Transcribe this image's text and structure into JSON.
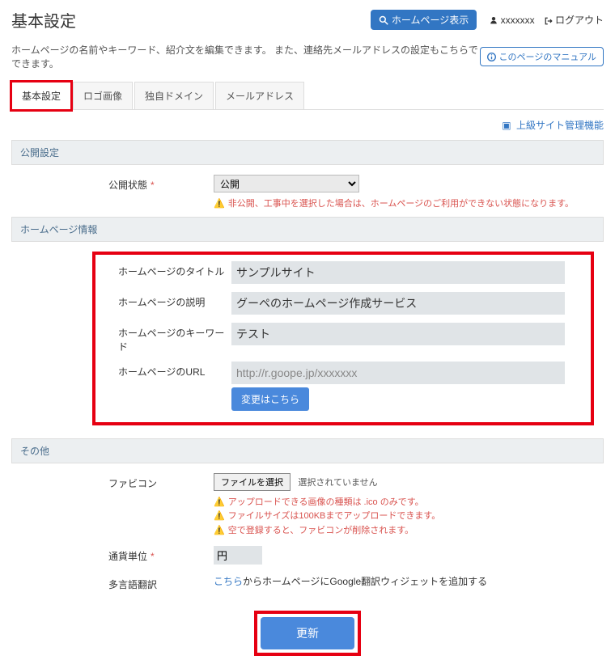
{
  "header": {
    "page_title": "基本設定",
    "view_hp_label": "ホームページ表示",
    "username": "xxxxxxx",
    "logout_label": "ログアウト"
  },
  "description": "ホームページの名前やキーワード、紹介文を編集できます。 また、連絡先メールアドレスの設定もこちらでできます。",
  "manual_link": "このページのマニュアル",
  "tabs": [
    "基本設定",
    "ロゴ画像",
    "独自ドメイン",
    "メールアドレス"
  ],
  "ext_link": "上級サイト管理機能",
  "sections": {
    "publish": {
      "title": "公開設定",
      "status_label": "公開状態",
      "status_value": "公開",
      "warn": "非公開、工事中を選択した場合は、ホームページのご利用ができない状態になります。"
    },
    "hpinfo": {
      "title": "ホームページ情報",
      "rows": {
        "title_label": "ホームページのタイトル",
        "title_value": "サンプルサイト",
        "desc_label": "ホームページの説明",
        "desc_value": "グーペのホームページ作成サービス",
        "kw_label": "ホームページのキーワード",
        "kw_value": "テスト",
        "url_label": "ホームページのURL",
        "url_value": "http://r.goope.jp/xxxxxxx",
        "change_btn": "変更はこちら"
      }
    },
    "other": {
      "title": "その他",
      "favicon_label": "ファビコン",
      "file_btn": "ファイルを選択",
      "file_none": "選択されていません",
      "warn1": "アップロードできる画像の種類は .ico のみです。",
      "warn2": "ファイルサイズは100KBまでアップロードできます。",
      "warn3": "空で登録すると、ファビコンが削除されます。",
      "currency_label": "通貨単位",
      "currency_value": "円",
      "lang_label": "多言語翻訳",
      "lang_link": "こちら",
      "lang_rest": "からホームページにGoogle翻訳ウィジェットを追加する"
    }
  },
  "submit": "更新"
}
